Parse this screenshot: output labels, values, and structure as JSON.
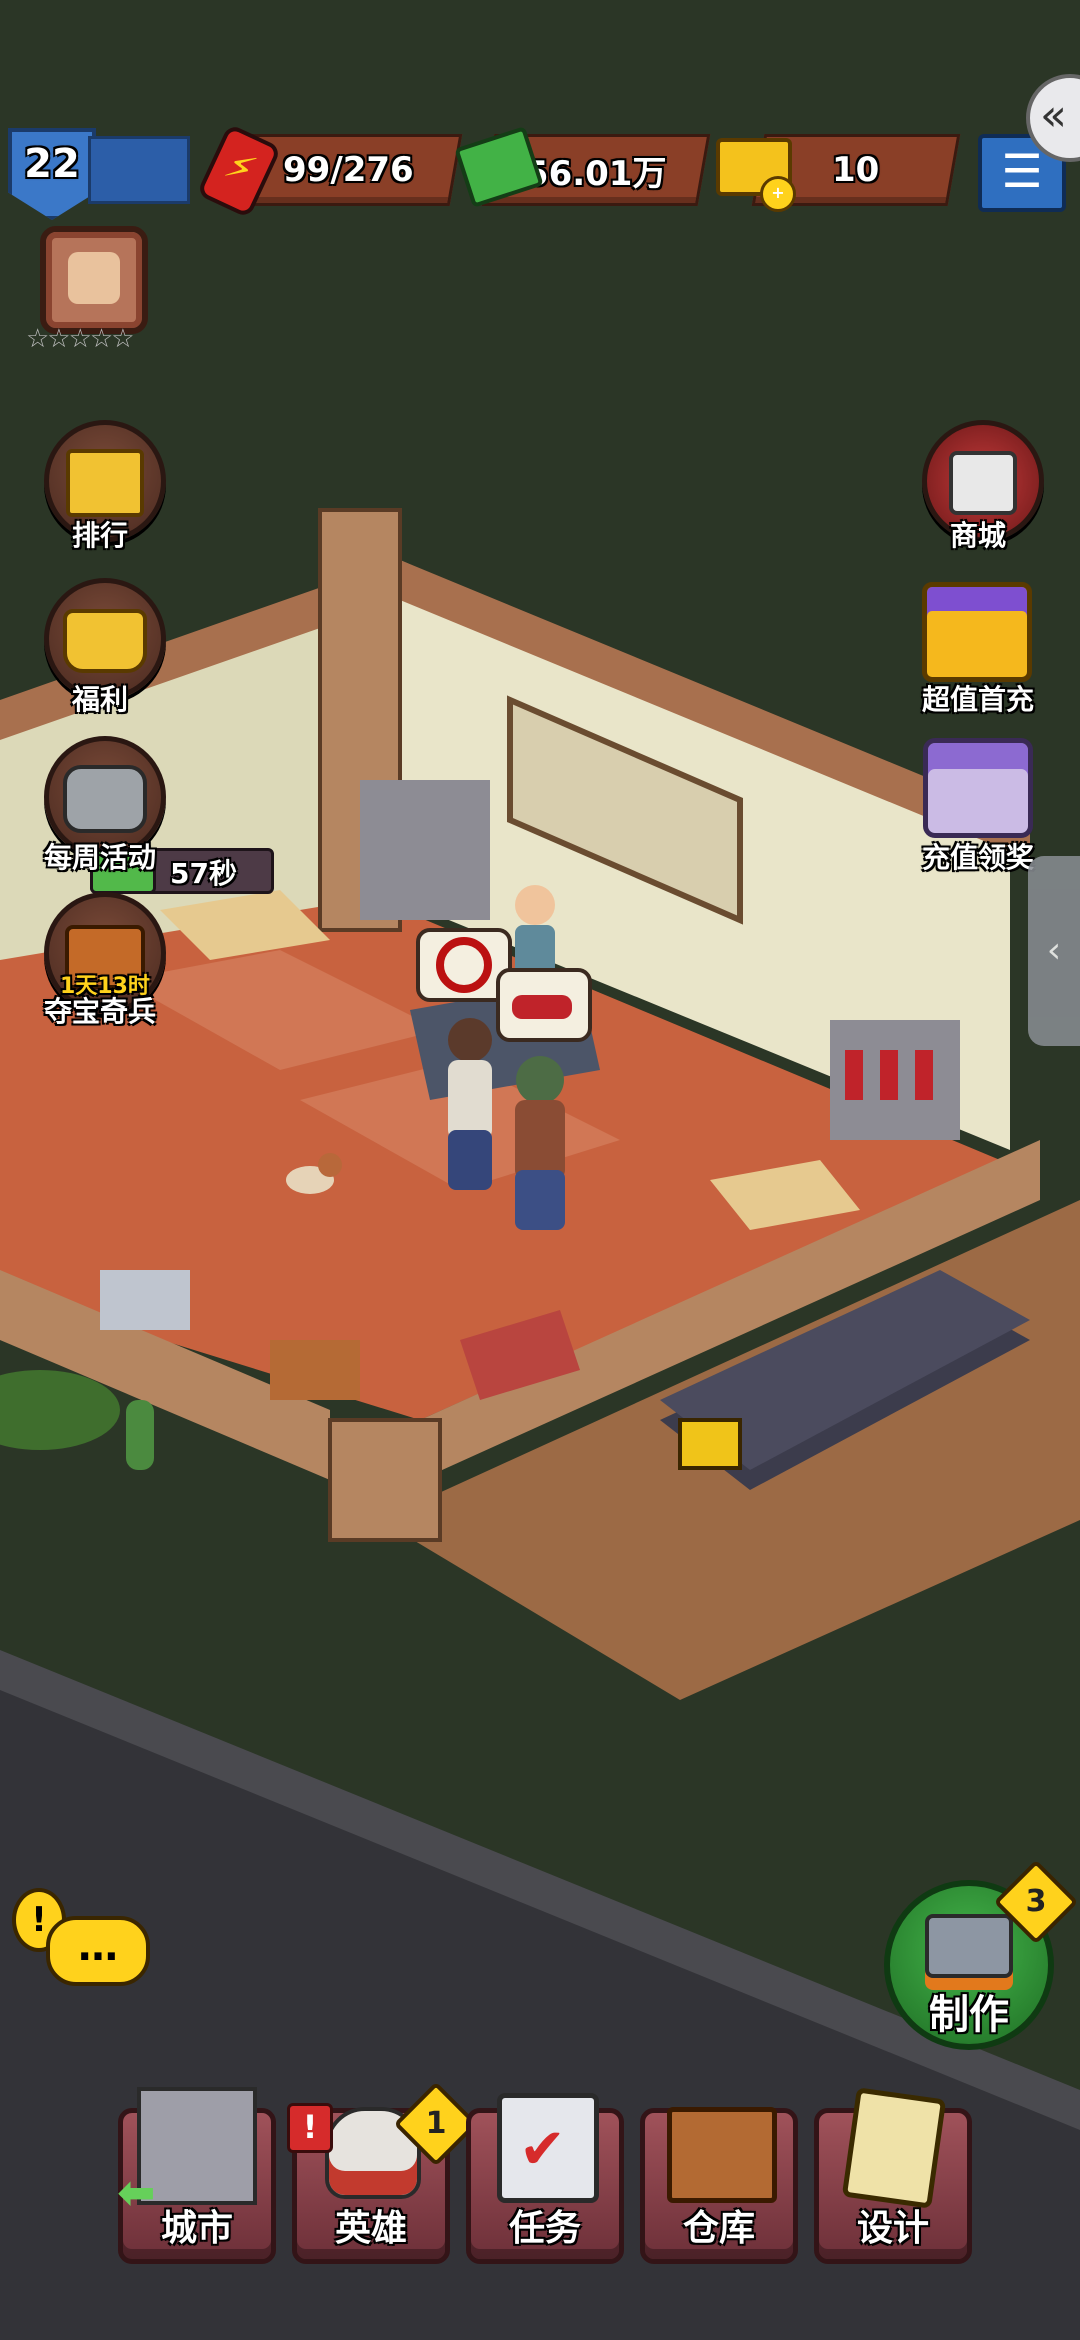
{
  "hud": {
    "level": "22",
    "energy": "99/276",
    "cash": "56.01万",
    "gold": "10",
    "rating_stars": "☆☆☆☆☆"
  },
  "left_menu": [
    {
      "label": "排行",
      "icon": "podium-trophy-icon"
    },
    {
      "label": "福利",
      "icon": "gold-cart-icon"
    },
    {
      "label": "每周活动",
      "icon": "weekly-gauntlets-icon",
      "timer": "57秒"
    },
    {
      "label": "夺宝奇兵",
      "icon": "treasure-chest-icon",
      "timer": "1天13时"
    }
  ],
  "right_menu": [
    {
      "label": "商城",
      "icon": "shop-cart-icon"
    },
    {
      "label": "超值首充",
      "icon": "gift-box-icon"
    },
    {
      "label": "充值领奖",
      "icon": "purple-chest-icon"
    }
  ],
  "craft": {
    "label": "制作",
    "badge": "3"
  },
  "chat": {
    "icon": "chat-bubble-icon"
  },
  "bottom_nav": [
    {
      "label": "城市",
      "icon": "city-building-icon",
      "badge": ""
    },
    {
      "label": "英雄",
      "icon": "hero-helmet-icon",
      "badge": "1"
    },
    {
      "label": "任务",
      "icon": "clipboard-task-icon",
      "badge": ""
    },
    {
      "label": "仓库",
      "icon": "crate-icon",
      "badge": ""
    },
    {
      "label": "设计",
      "icon": "blueprint-scroll-icon",
      "badge": ""
    }
  ],
  "colors": {
    "grass": "#2b3626",
    "floor": "#c8623f",
    "wall": "#e9e5c9",
    "accent": "#ffd21c",
    "craft_green": "#33a53a"
  }
}
